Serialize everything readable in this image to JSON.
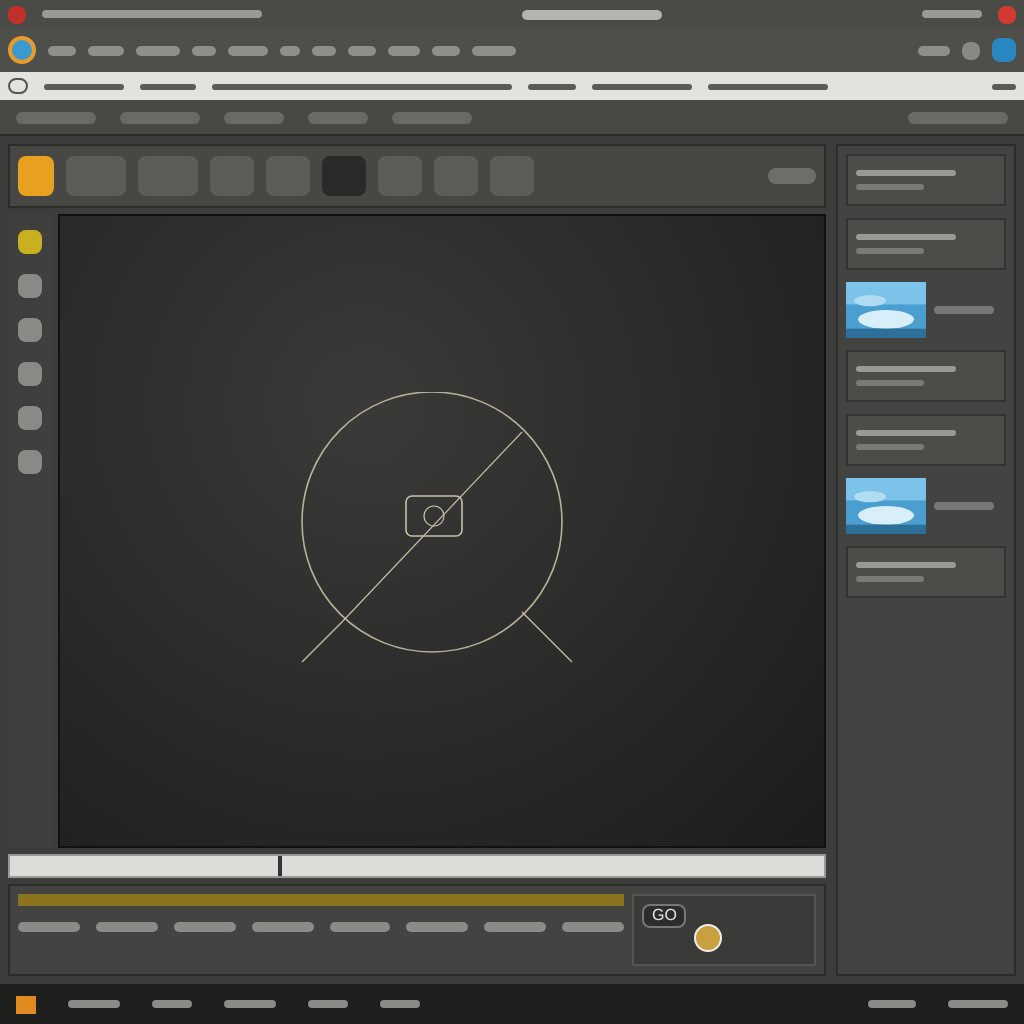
{
  "toolbar_tools": [
    {
      "selected": true
    },
    {
      "selected": false
    },
    {
      "selected": false
    },
    {
      "selected": false
    },
    {
      "selected": false
    },
    {
      "selected": true
    },
    {
      "selected": false
    },
    {
      "selected": false
    },
    {
      "selected": false
    }
  ],
  "side_tools": [
    {
      "selected": true
    },
    {
      "selected": false
    },
    {
      "selected": false
    },
    {
      "selected": false
    },
    {
      "selected": false
    },
    {
      "selected": false
    }
  ],
  "right_panel": [
    {
      "kind": "row"
    },
    {
      "kind": "row"
    },
    {
      "kind": "picture"
    },
    {
      "kind": "row"
    },
    {
      "kind": "row"
    },
    {
      "kind": "picture"
    },
    {
      "kind": "row"
    }
  ],
  "timeline": {
    "playhead": {
      "level": 0.33
    }
  },
  "controls": {
    "button": "GO"
  }
}
